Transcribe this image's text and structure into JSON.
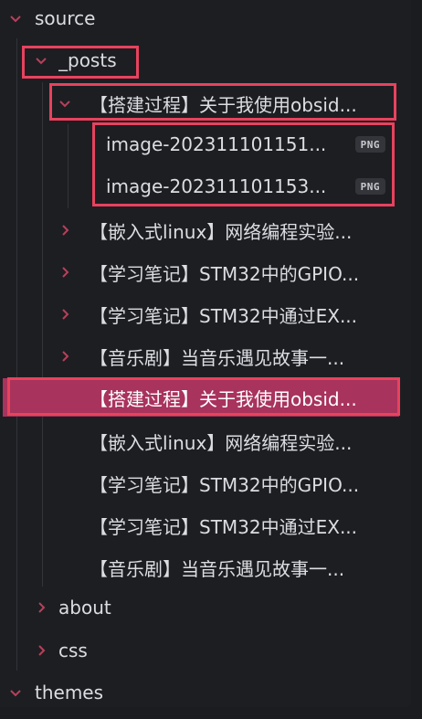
{
  "tree": {
    "source": {
      "label": "source",
      "icon": "chevron-down-icon"
    },
    "posts": {
      "label": "_posts",
      "icon": "chevron-down-icon"
    },
    "expanded_post": {
      "label": "【搭建过程】关于我使用obsid...",
      "icon": "chevron-down-icon",
      "files": [
        {
          "name": "image-202311101151...",
          "badge": "PNG"
        },
        {
          "name": "image-202311101153...",
          "badge": "PNG"
        }
      ]
    },
    "collapsed_folders": [
      {
        "label": "【嵌入式linux】网络编程实验...",
        "icon": "chevron-right-icon"
      },
      {
        "label": "【学习笔记】STM32中的GPIO...",
        "icon": "chevron-right-icon"
      },
      {
        "label": "【学习笔记】STM32中通过EX...",
        "icon": "chevron-right-icon"
      },
      {
        "label": "【音乐剧】当音乐遇见故事一...",
        "icon": "chevron-right-icon"
      }
    ],
    "selected_file": {
      "label": "【搭建过程】关于我使用obsid..."
    },
    "files": [
      {
        "label": "【嵌入式linux】网络编程实验..."
      },
      {
        "label": "【学习笔记】STM32中的GPIO..."
      },
      {
        "label": "【学习笔记】STM32中通过EX..."
      },
      {
        "label": "【音乐剧】当音乐遇见故事一..."
      }
    ],
    "about": {
      "label": "about",
      "icon": "chevron-right-icon"
    },
    "css": {
      "label": "css",
      "icon": "chevron-right-icon"
    },
    "themes": {
      "label": "themes",
      "icon": "chevron-down-icon"
    }
  },
  "colors": {
    "background": "#1d1e22",
    "text": "#dcdde2",
    "chevron": "#b6415a",
    "selected_row": "#a8335d",
    "highlight_border": "#e8425e",
    "badge_bg": "#34353a"
  }
}
